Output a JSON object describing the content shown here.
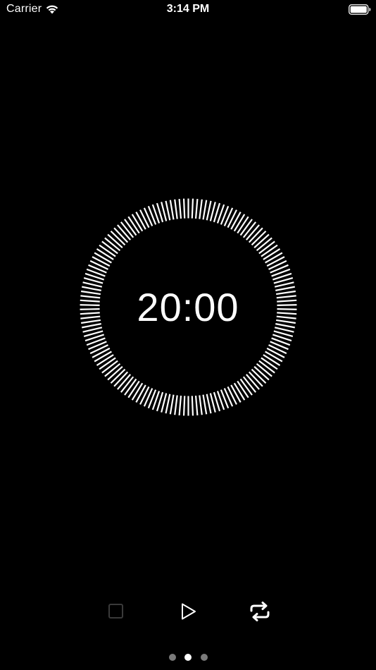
{
  "status_bar": {
    "carrier": "Carrier",
    "time": "3:14 PM",
    "wifi_icon": "wifi-icon",
    "battery_icon": "battery-full-icon"
  },
  "timer": {
    "display": "20:00",
    "progress": 1.0,
    "ring_color": "#ffffff",
    "background": "#000000"
  },
  "controls": [
    {
      "name": "stop",
      "icon": "stop-square-icon",
      "enabled": false
    },
    {
      "name": "play",
      "icon": "play-icon",
      "enabled": true
    },
    {
      "name": "repeat",
      "icon": "repeat-icon",
      "enabled": true
    }
  ],
  "pagination": {
    "count": 3,
    "active_index": 1
  },
  "colors": {
    "foreground": "#ffffff",
    "disabled": "#3a3a3a",
    "inactive_dot": "#7a7a7a"
  }
}
